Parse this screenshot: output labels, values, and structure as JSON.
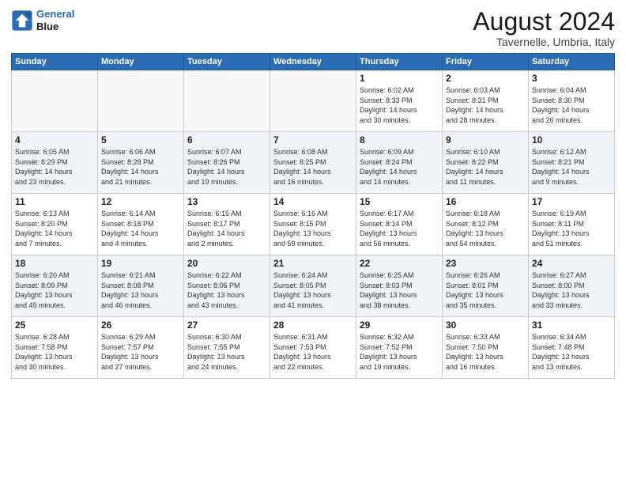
{
  "header": {
    "logo_line1": "General",
    "logo_line2": "Blue",
    "title": "August 2024",
    "subtitle": "Tavernelle, Umbria, Italy"
  },
  "weekdays": [
    "Sunday",
    "Monday",
    "Tuesday",
    "Wednesday",
    "Thursday",
    "Friday",
    "Saturday"
  ],
  "weeks": [
    [
      {
        "day": "",
        "info": ""
      },
      {
        "day": "",
        "info": ""
      },
      {
        "day": "",
        "info": ""
      },
      {
        "day": "",
        "info": ""
      },
      {
        "day": "1",
        "info": "Sunrise: 6:02 AM\nSunset: 8:33 PM\nDaylight: 14 hours\nand 30 minutes."
      },
      {
        "day": "2",
        "info": "Sunrise: 6:03 AM\nSunset: 8:31 PM\nDaylight: 14 hours\nand 28 minutes."
      },
      {
        "day": "3",
        "info": "Sunrise: 6:04 AM\nSunset: 8:30 PM\nDaylight: 14 hours\nand 26 minutes."
      }
    ],
    [
      {
        "day": "4",
        "info": "Sunrise: 6:05 AM\nSunset: 8:29 PM\nDaylight: 14 hours\nand 23 minutes."
      },
      {
        "day": "5",
        "info": "Sunrise: 6:06 AM\nSunset: 8:28 PM\nDaylight: 14 hours\nand 21 minutes."
      },
      {
        "day": "6",
        "info": "Sunrise: 6:07 AM\nSunset: 8:26 PM\nDaylight: 14 hours\nand 19 minutes."
      },
      {
        "day": "7",
        "info": "Sunrise: 6:08 AM\nSunset: 8:25 PM\nDaylight: 14 hours\nand 16 minutes."
      },
      {
        "day": "8",
        "info": "Sunrise: 6:09 AM\nSunset: 8:24 PM\nDaylight: 14 hours\nand 14 minutes."
      },
      {
        "day": "9",
        "info": "Sunrise: 6:10 AM\nSunset: 8:22 PM\nDaylight: 14 hours\nand 11 minutes."
      },
      {
        "day": "10",
        "info": "Sunrise: 6:12 AM\nSunset: 8:21 PM\nDaylight: 14 hours\nand 9 minutes."
      }
    ],
    [
      {
        "day": "11",
        "info": "Sunrise: 6:13 AM\nSunset: 8:20 PM\nDaylight: 14 hours\nand 7 minutes."
      },
      {
        "day": "12",
        "info": "Sunrise: 6:14 AM\nSunset: 8:18 PM\nDaylight: 14 hours\nand 4 minutes."
      },
      {
        "day": "13",
        "info": "Sunrise: 6:15 AM\nSunset: 8:17 PM\nDaylight: 14 hours\nand 2 minutes."
      },
      {
        "day": "14",
        "info": "Sunrise: 6:16 AM\nSunset: 8:15 PM\nDaylight: 13 hours\nand 59 minutes."
      },
      {
        "day": "15",
        "info": "Sunrise: 6:17 AM\nSunset: 8:14 PM\nDaylight: 13 hours\nand 56 minutes."
      },
      {
        "day": "16",
        "info": "Sunrise: 6:18 AM\nSunset: 8:12 PM\nDaylight: 13 hours\nand 54 minutes."
      },
      {
        "day": "17",
        "info": "Sunrise: 6:19 AM\nSunset: 8:11 PM\nDaylight: 13 hours\nand 51 minutes."
      }
    ],
    [
      {
        "day": "18",
        "info": "Sunrise: 6:20 AM\nSunset: 8:09 PM\nDaylight: 13 hours\nand 49 minutes."
      },
      {
        "day": "19",
        "info": "Sunrise: 6:21 AM\nSunset: 8:08 PM\nDaylight: 13 hours\nand 46 minutes."
      },
      {
        "day": "20",
        "info": "Sunrise: 6:22 AM\nSunset: 8:06 PM\nDaylight: 13 hours\nand 43 minutes."
      },
      {
        "day": "21",
        "info": "Sunrise: 6:24 AM\nSunset: 8:05 PM\nDaylight: 13 hours\nand 41 minutes."
      },
      {
        "day": "22",
        "info": "Sunrise: 6:25 AM\nSunset: 8:03 PM\nDaylight: 13 hours\nand 38 minutes."
      },
      {
        "day": "23",
        "info": "Sunrise: 6:26 AM\nSunset: 8:01 PM\nDaylight: 13 hours\nand 35 minutes."
      },
      {
        "day": "24",
        "info": "Sunrise: 6:27 AM\nSunset: 8:00 PM\nDaylight: 13 hours\nand 33 minutes."
      }
    ],
    [
      {
        "day": "25",
        "info": "Sunrise: 6:28 AM\nSunset: 7:58 PM\nDaylight: 13 hours\nand 30 minutes."
      },
      {
        "day": "26",
        "info": "Sunrise: 6:29 AM\nSunset: 7:57 PM\nDaylight: 13 hours\nand 27 minutes."
      },
      {
        "day": "27",
        "info": "Sunrise: 6:30 AM\nSunset: 7:55 PM\nDaylight: 13 hours\nand 24 minutes."
      },
      {
        "day": "28",
        "info": "Sunrise: 6:31 AM\nSunset: 7:53 PM\nDaylight: 13 hours\nand 22 minutes."
      },
      {
        "day": "29",
        "info": "Sunrise: 6:32 AM\nSunset: 7:52 PM\nDaylight: 13 hours\nand 19 minutes."
      },
      {
        "day": "30",
        "info": "Sunrise: 6:33 AM\nSunset: 7:50 PM\nDaylight: 13 hours\nand 16 minutes."
      },
      {
        "day": "31",
        "info": "Sunrise: 6:34 AM\nSunset: 7:48 PM\nDaylight: 13 hours\nand 13 minutes."
      }
    ]
  ]
}
